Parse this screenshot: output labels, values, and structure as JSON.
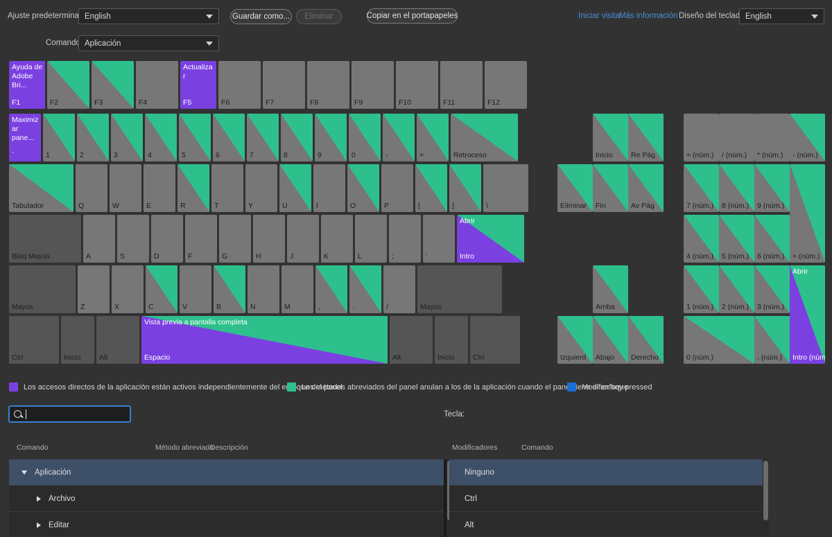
{
  "toolbar": {
    "preset_label": "Ajuste predeterminado:",
    "preset_value": "English",
    "save_as_label": "Guardar como...",
    "delete_label": "Eliminar",
    "copy_clipboard_label": "Copiar en el portapapeles",
    "start_tour_label": "Iniciar visita",
    "more_info_label": "Más información",
    "keyboard_layout_label": "Diseño del teclado:",
    "keyboard_layout_value": "English",
    "commands_label": "Comandos:",
    "commands_value": "Aplicación"
  },
  "legend": {
    "app_color": "#7b40e0",
    "app_text": "Los accesos directos de la aplicación están activos independientemente del enfoque del panel",
    "panel_color": "#2ec08c",
    "panel_text": "Los métodos abreviados del panel anulan a los de la aplicación cuando el panel tiene el enfoque",
    "modifier_color": "#1a6fd4",
    "modifier_text": "Modifier key pressed"
  },
  "search": {
    "placeholder": "",
    "value": "",
    "icon": "search-icon"
  },
  "key_label": "Tecla:",
  "left_panel": {
    "headers": [
      "Comando",
      "Método abreviado",
      "Descripción"
    ],
    "rows": [
      {
        "label": "Aplicación",
        "indent": 0,
        "expanded": true,
        "selected": true
      },
      {
        "label": "Archivo",
        "indent": 1,
        "expanded": false,
        "selected": false
      },
      {
        "label": "Editar",
        "indent": 1,
        "expanded": false,
        "selected": false
      }
    ]
  },
  "right_panel": {
    "headers": [
      "Modificadores",
      "Comando"
    ],
    "rows": [
      {
        "label": "Ninguno",
        "selected": true
      },
      {
        "label": "Ctrl",
        "selected": false
      },
      {
        "label": "Alt",
        "selected": false
      }
    ]
  },
  "keyboard": {
    "function_row": [
      {
        "name": "F1",
        "cmd": "Ayuda de Adobe Bri...",
        "style": "purple"
      },
      {
        "name": "F2",
        "cmd": "",
        "style": "panel"
      },
      {
        "name": "F3",
        "cmd": "",
        "style": "panel"
      },
      {
        "name": "F4",
        "cmd": "",
        "style": "plain"
      },
      {
        "name": "F5",
        "cmd": "Actualizar",
        "style": "purple"
      },
      {
        "name": "F6",
        "cmd": "",
        "style": "plain"
      },
      {
        "name": "F7",
        "cmd": "",
        "style": "plain"
      },
      {
        "name": "F8",
        "cmd": "",
        "style": "plain"
      },
      {
        "name": "F9",
        "cmd": "",
        "style": "plain"
      },
      {
        "name": "F10",
        "cmd": "",
        "style": "plain"
      },
      {
        "name": "F11",
        "cmd": "",
        "style": "plain"
      },
      {
        "name": "F12",
        "cmd": "",
        "style": "plain"
      }
    ],
    "number_row": [
      {
        "name": "`",
        "cmd": "Maximizar pane...",
        "style": "purple"
      },
      {
        "name": "1",
        "cmd": "",
        "style": "panel"
      },
      {
        "name": "2",
        "cmd": "",
        "style": "panel"
      },
      {
        "name": "3",
        "cmd": "",
        "style": "panel"
      },
      {
        "name": "4",
        "cmd": "",
        "style": "panel"
      },
      {
        "name": "5",
        "cmd": "",
        "style": "panel"
      },
      {
        "name": "6",
        "cmd": "",
        "style": "panel"
      },
      {
        "name": "7",
        "cmd": "",
        "style": "panel"
      },
      {
        "name": "8",
        "cmd": "",
        "style": "panel"
      },
      {
        "name": "9",
        "cmd": "",
        "style": "panel"
      },
      {
        "name": "0",
        "cmd": "",
        "style": "panel"
      },
      {
        "name": "-",
        "cmd": "",
        "style": "panel"
      },
      {
        "name": "=",
        "cmd": "",
        "style": "panel"
      },
      {
        "name": "Retroceso",
        "cmd": "",
        "style": "panel"
      }
    ],
    "tab_row": [
      {
        "name": "Tabulador",
        "cmd": "",
        "style": "panel"
      },
      {
        "name": "Q",
        "cmd": "",
        "style": "plain"
      },
      {
        "name": "W",
        "cmd": "",
        "style": "plain"
      },
      {
        "name": "E",
        "cmd": "",
        "style": "plain"
      },
      {
        "name": "R",
        "cmd": "",
        "style": "panel"
      },
      {
        "name": "T",
        "cmd": "",
        "style": "plain"
      },
      {
        "name": "Y",
        "cmd": "",
        "style": "plain"
      },
      {
        "name": "U",
        "cmd": "",
        "style": "panel"
      },
      {
        "name": "I",
        "cmd": "",
        "style": "plain"
      },
      {
        "name": "O",
        "cmd": "",
        "style": "panel"
      },
      {
        "name": "P",
        "cmd": "",
        "style": "plain"
      },
      {
        "name": "[",
        "cmd": "",
        "style": "panel"
      },
      {
        "name": "]",
        "cmd": "",
        "style": "panel"
      },
      {
        "name": "\\",
        "cmd": "",
        "style": "plain"
      }
    ],
    "caps_row": [
      {
        "name": "Bloq Mayús",
        "cmd": "",
        "style": "dark"
      },
      {
        "name": "A",
        "cmd": "",
        "style": "plain"
      },
      {
        "name": "S",
        "cmd": "",
        "style": "plain"
      },
      {
        "name": "D",
        "cmd": "",
        "style": "plain"
      },
      {
        "name": "F",
        "cmd": "",
        "style": "plain"
      },
      {
        "name": "G",
        "cmd": "",
        "style": "plain"
      },
      {
        "name": "H",
        "cmd": "",
        "style": "plain"
      },
      {
        "name": "J",
        "cmd": "",
        "style": "plain"
      },
      {
        "name": "K",
        "cmd": "",
        "style": "plain"
      },
      {
        "name": "L",
        "cmd": "",
        "style": "plain"
      },
      {
        "name": ";",
        "cmd": "",
        "style": "plain"
      },
      {
        "name": "'",
        "cmd": "",
        "style": "plain"
      },
      {
        "name": "Intro",
        "cmd": "Abrir",
        "style": "purple-panel"
      }
    ],
    "shift_row": [
      {
        "name": "Mayús",
        "cmd": "",
        "style": "dark"
      },
      {
        "name": "Z",
        "cmd": "",
        "style": "plain"
      },
      {
        "name": "X",
        "cmd": "",
        "style": "plain"
      },
      {
        "name": "C",
        "cmd": "",
        "style": "panel"
      },
      {
        "name": "V",
        "cmd": "",
        "style": "plain"
      },
      {
        "name": "B",
        "cmd": "",
        "style": "panel"
      },
      {
        "name": "N",
        "cmd": "",
        "style": "plain"
      },
      {
        "name": "M",
        "cmd": "",
        "style": "plain"
      },
      {
        "name": ",",
        "cmd": "",
        "style": "panel"
      },
      {
        "name": ".",
        "cmd": "",
        "style": "panel"
      },
      {
        "name": "/",
        "cmd": "",
        "style": "plain"
      },
      {
        "name": "Mayús",
        "cmd": "",
        "style": "dark"
      }
    ],
    "space_row": [
      {
        "name": "Ctrl",
        "cmd": "",
        "style": "dark"
      },
      {
        "name": "Inicio",
        "cmd": "",
        "style": "dark"
      },
      {
        "name": "Alt",
        "cmd": "",
        "style": "dark"
      },
      {
        "name": "Espacio",
        "cmd": "Vista previa a pantalla completa",
        "style": "purple-panel"
      },
      {
        "name": "Alt",
        "cmd": "",
        "style": "dark"
      },
      {
        "name": "Inicio",
        "cmd": "",
        "style": "dark"
      },
      {
        "name": "Ctrl",
        "cmd": "",
        "style": "dark"
      }
    ],
    "nav_cluster": [
      {
        "name": "Inicio",
        "cmd": "",
        "style": "panel"
      },
      {
        "name": "Re Pág",
        "cmd": "",
        "style": "panel"
      },
      {
        "name": "Eliminar",
        "cmd": "",
        "style": "panel"
      },
      {
        "name": "Fin",
        "cmd": "",
        "style": "panel"
      },
      {
        "name": "Av Pág",
        "cmd": "",
        "style": "panel"
      },
      {
        "name": "Arriba",
        "cmd": "",
        "style": "panel"
      },
      {
        "name": "Izquierd",
        "cmd": "",
        "style": "panel"
      },
      {
        "name": "Abajo",
        "cmd": "",
        "style": "panel"
      },
      {
        "name": "Derecho",
        "cmd": "",
        "style": "panel"
      }
    ],
    "numpad": [
      {
        "name": "= (núm.)",
        "cmd": "",
        "style": "plain"
      },
      {
        "name": "/ (núm.)",
        "cmd": "",
        "style": "plain"
      },
      {
        "name": "* (núm.)",
        "cmd": "",
        "style": "plain"
      },
      {
        "name": "- (núm.)",
        "cmd": "",
        "style": "panel"
      },
      {
        "name": "7 (núm.)",
        "cmd": "",
        "style": "panel"
      },
      {
        "name": "8 (núm.)",
        "cmd": "",
        "style": "panel"
      },
      {
        "name": "9 (núm.)",
        "cmd": "",
        "style": "panel"
      },
      {
        "name": "+ (núm.)",
        "cmd": "",
        "style": "panel"
      },
      {
        "name": "4 (núm.)",
        "cmd": "",
        "style": "panel"
      },
      {
        "name": "5 (núm.)",
        "cmd": "",
        "style": "panel"
      },
      {
        "name": "6 (núm.)",
        "cmd": "",
        "style": "panel"
      },
      {
        "name": "1 (núm.)",
        "cmd": "",
        "style": "panel"
      },
      {
        "name": "2 (núm.)",
        "cmd": "",
        "style": "panel"
      },
      {
        "name": "3 (núm.)",
        "cmd": "",
        "style": "panel"
      },
      {
        "name": "Intro (núm.)",
        "cmd": "Abrir",
        "style": "purple-panel"
      },
      {
        "name": "0 (núm.)",
        "cmd": "",
        "style": "panel"
      },
      {
        "name": ". (núm.)",
        "cmd": "",
        "style": "panel"
      }
    ]
  }
}
